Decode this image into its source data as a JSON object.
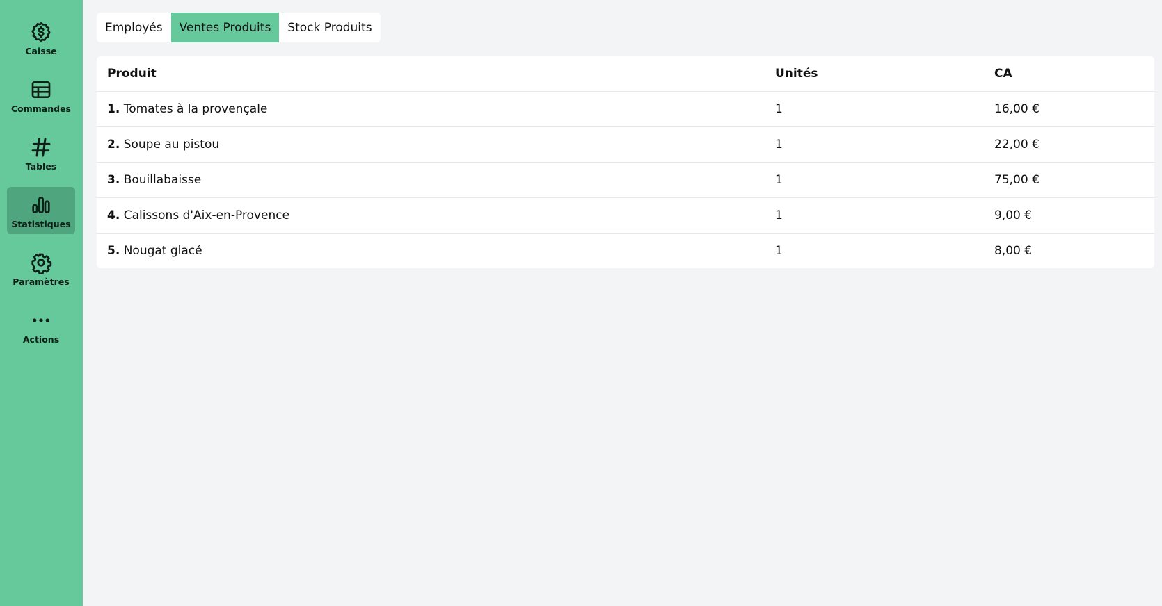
{
  "sidebar": {
    "items": [
      {
        "label": "Caisse",
        "icon": "dollar-circle-icon"
      },
      {
        "label": "Commandes",
        "icon": "table-grid-icon"
      },
      {
        "label": "Tables",
        "icon": "hash-icon"
      },
      {
        "label": "Statistiques",
        "icon": "bar-chart-icon"
      },
      {
        "label": "Paramètres",
        "icon": "gear-icon"
      },
      {
        "label": "Actions",
        "icon": "more-dots-icon"
      }
    ],
    "active": "Statistiques"
  },
  "tabs": [
    {
      "label": "Employés"
    },
    {
      "label": "Ventes Produits"
    },
    {
      "label": "Stock Produits"
    }
  ],
  "active_tab": "Ventes Produits",
  "table": {
    "headers": [
      "Produit",
      "Unités",
      "CA"
    ],
    "rows": [
      {
        "rank": "1.",
        "product": "Tomates à la provençale",
        "units": "1",
        "ca": "16,00 €"
      },
      {
        "rank": "2.",
        "product": "Soupe au pistou",
        "units": "1",
        "ca": "22,00 €"
      },
      {
        "rank": "3.",
        "product": "Bouillabaisse",
        "units": "1",
        "ca": "75,00 €"
      },
      {
        "rank": "4.",
        "product": "Calissons d'Aix-en-Provence",
        "units": "1",
        "ca": "9,00 €"
      },
      {
        "rank": "5.",
        "product": "Nougat glacé",
        "units": "1",
        "ca": "8,00 €"
      }
    ]
  },
  "colors": {
    "sidebar_bg": "#66c99b",
    "sidebar_active": "#4fa57e",
    "tab_active": "#66c99b",
    "page_bg": "#f3f4f6"
  }
}
